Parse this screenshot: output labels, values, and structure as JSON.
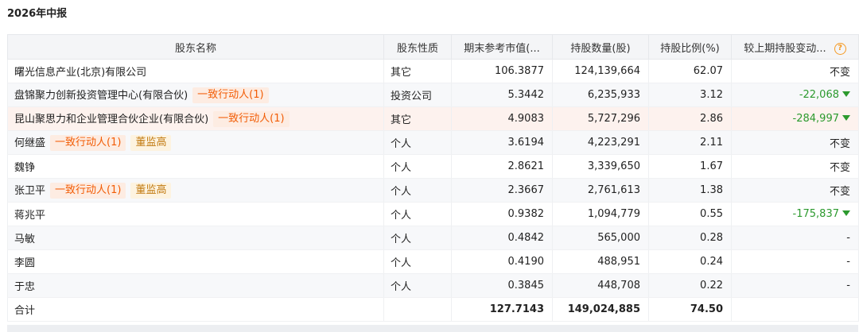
{
  "title": "2026年中报",
  "columns": {
    "name": "股东名称",
    "nature": "股东性质",
    "market_value": "期末参考市值(...",
    "shares": "持股数量(股)",
    "ratio": "持股比例(%)",
    "change": "较上期持股变动..."
  },
  "rows": [
    {
      "name": "曙光信息产业(北京)有限公司",
      "tags": [],
      "nature": "其它",
      "market_value": "106.3877",
      "shares": "124,139,664",
      "ratio": "62.07",
      "change": "不变",
      "change_dir": "none"
    },
    {
      "name": "盘锦聚力创新投资管理中心(有限合伙)",
      "tags": [
        {
          "text": "一致行动人(1)",
          "style": "orange"
        }
      ],
      "nature": "投资公司",
      "market_value": "5.3442",
      "shares": "6,235,933",
      "ratio": "3.12",
      "change": "-22,068",
      "change_dir": "down"
    },
    {
      "name": "昆山聚思力和企业管理合伙企业(有限合伙)",
      "tags": [
        {
          "text": "一致行动人(1)",
          "style": "orange"
        }
      ],
      "nature": "其它",
      "market_value": "4.9083",
      "shares": "5,727,296",
      "ratio": "2.86",
      "change": "-284,997",
      "change_dir": "down"
    },
    {
      "name": "何继盛",
      "tags": [
        {
          "text": "一致行动人(1)",
          "style": "orange"
        },
        {
          "text": "董监高",
          "style": "yellow"
        }
      ],
      "nature": "个人",
      "market_value": "3.6194",
      "shares": "4,223,291",
      "ratio": "2.11",
      "change": "不变",
      "change_dir": "none"
    },
    {
      "name": "魏铮",
      "tags": [],
      "nature": "个人",
      "market_value": "2.8621",
      "shares": "3,339,650",
      "ratio": "1.67",
      "change": "不变",
      "change_dir": "none"
    },
    {
      "name": "张卫平",
      "tags": [
        {
          "text": "一致行动人(1)",
          "style": "orange"
        },
        {
          "text": "董监高",
          "style": "yellow"
        }
      ],
      "nature": "个人",
      "market_value": "2.3667",
      "shares": "2,761,613",
      "ratio": "1.38",
      "change": "不变",
      "change_dir": "none"
    },
    {
      "name": "蒋兆平",
      "tags": [],
      "nature": "个人",
      "market_value": "0.9382",
      "shares": "1,094,779",
      "ratio": "0.55",
      "change": "-175,837",
      "change_dir": "down"
    },
    {
      "name": "马敏",
      "tags": [],
      "nature": "个人",
      "market_value": "0.4842",
      "shares": "565,000",
      "ratio": "0.28",
      "change": "-",
      "change_dir": "none"
    },
    {
      "name": "李圆",
      "tags": [],
      "nature": "个人",
      "market_value": "0.4190",
      "shares": "488,951",
      "ratio": "0.24",
      "change": "-",
      "change_dir": "none"
    },
    {
      "name": "于忠",
      "tags": [],
      "nature": "个人",
      "market_value": "0.3845",
      "shares": "448,708",
      "ratio": "0.22",
      "change": "-",
      "change_dir": "none"
    }
  ],
  "highlight_row_index": 2,
  "total": {
    "name": "合计",
    "nature": "",
    "market_value": "127.7143",
    "shares": "149,024,885",
    "ratio": "74.50",
    "change": ""
  },
  "icons": {
    "help": "question-circle-icon",
    "down": "triangle-down-icon"
  },
  "colors": {
    "negative": "#2c9a2e",
    "tag_orange": "#f25c05",
    "tag_yellow": "#c17a10",
    "help": "#f59a23"
  }
}
